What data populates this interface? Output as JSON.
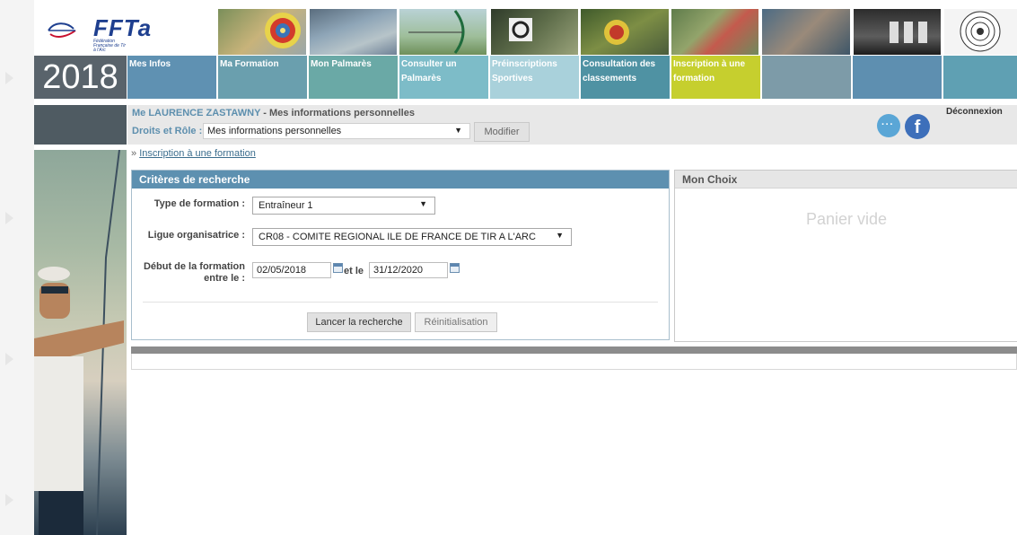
{
  "brand": {
    "logo_text": "FFTa",
    "logo_subtitle": "Fédération Française de Tir à l'Arc",
    "year": "2018",
    "brand_color": "#1e3f8f"
  },
  "nav": [
    {
      "label": "Mes Infos",
      "color": "#5f91b2"
    },
    {
      "label": "Ma Formation",
      "color": "#6a9fae"
    },
    {
      "label": "Mon Palmarès",
      "color": "#6aa9a6"
    },
    {
      "label": "Consulter un Palmarès",
      "color": "#7dbcc8"
    },
    {
      "label": "Préinscriptions Sportives",
      "color": "#a9d1db"
    },
    {
      "label": "Consultation des classements",
      "color": "#4f92a3"
    },
    {
      "label": "Inscription à une formation",
      "color": "#c6cf2e"
    },
    {
      "label": "",
      "color": "#7d9ba8"
    },
    {
      "label": "",
      "color": "#5e8fb0"
    },
    {
      "label": "",
      "color": "#5fa0b3"
    }
  ],
  "user": {
    "name": "Me LAURENCE ZASTAWNY",
    "suffix": " - Mes informations personnelles",
    "role_label": "Droits et Rôle :",
    "role_value": "Mes informations personnelles",
    "modify_label": "Modifier",
    "logout_label": "Déconnexion",
    "chat_icon": "chat-bubble-icon",
    "facebook_icon": "facebook-icon"
  },
  "breadcrumb": {
    "prefix": "» ",
    "link": "Inscription à une  formation"
  },
  "search": {
    "title": "Critères de recherche",
    "type_label": "Type de formation :",
    "type_value": "Entraîneur 1",
    "ligue_label": "Ligue organisatrice :",
    "ligue_value": "CR08 - COMITE REGIONAL ILE DE FRANCE DE TIR A L'ARC",
    "date_label_1": "Début de la formation",
    "date_label_2": "entre le :",
    "date_start": "02/05/2018",
    "date_joiner": "et le",
    "date_end": "31/12/2020",
    "search_button": "Lancer la recherche",
    "reset_button": "Réinitialisation"
  },
  "choice": {
    "title": "Mon Choix",
    "empty_text": "Panier vide"
  },
  "colors": {
    "panel_header": "#5d90b0",
    "accent_link": "#5d8fae"
  }
}
